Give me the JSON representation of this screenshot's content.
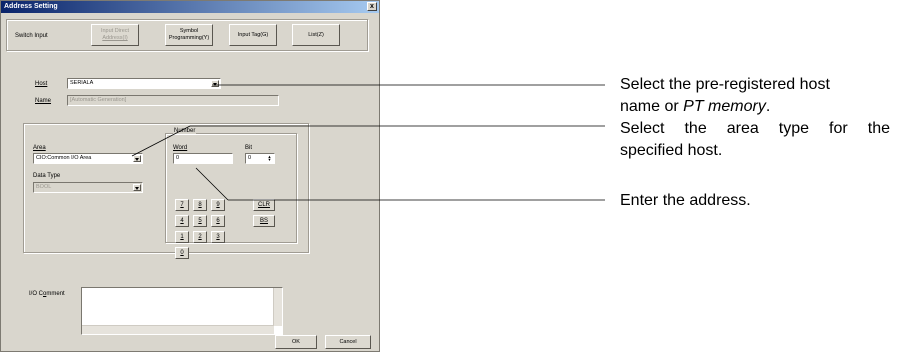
{
  "window": {
    "title": "Address Setting",
    "close": "x"
  },
  "modes": {
    "switch_input": "Switch Input",
    "input_direct": [
      "Input Direct",
      "Address(I)"
    ],
    "symbol": [
      "Symbol",
      "Programming(Y)"
    ],
    "input_tag": "Input Tag(G)",
    "list": "List(Z)"
  },
  "host": {
    "label": "Host",
    "value": "SERIALA"
  },
  "name": {
    "label": "Name",
    "value": "[Automatic Generation]"
  },
  "area": {
    "label": "Area",
    "value": "CIO:Common I/O Area"
  },
  "data_type": {
    "label": "Data Type",
    "value": "BOOL"
  },
  "number": {
    "group_label": "Number",
    "word_label": "Word",
    "word_value": "0",
    "bit_label": "Bit",
    "bit_value": "0"
  },
  "keypad": {
    "keys": [
      "7",
      "8",
      "9",
      "4",
      "5",
      "6",
      "1",
      "2",
      "3",
      "0"
    ],
    "clr": "CLR",
    "bs": "BS"
  },
  "io_comment": {
    "label": "I/O Comment"
  },
  "buttons": {
    "ok": "OK",
    "cancel": "Cancel"
  },
  "callouts": {
    "host_line1": "Select the pre-registered host",
    "host_line2a": "name or ",
    "host_line2b": "PT memory",
    "host_line2c": ".",
    "area_line1": "Select the area type for the",
    "area_line2": "specified host.",
    "address": "Enter the address."
  }
}
